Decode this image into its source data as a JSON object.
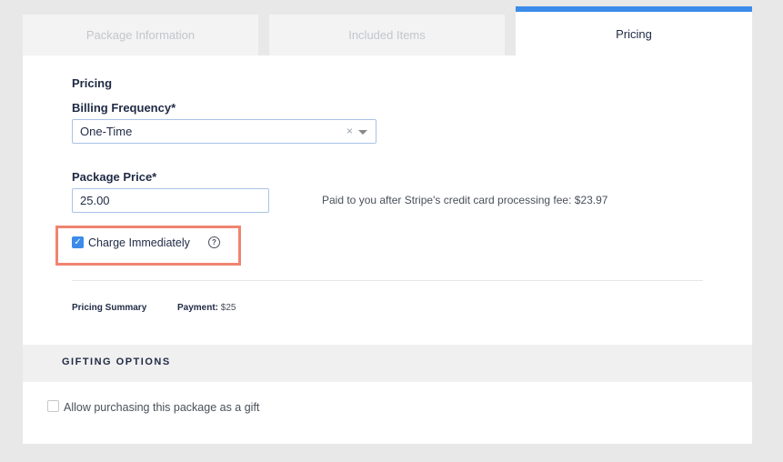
{
  "tabs": [
    {
      "label": "Package Information"
    },
    {
      "label": "Included Items"
    },
    {
      "label": "Pricing"
    }
  ],
  "colors": {
    "accent": "#3b8bea",
    "highlight": "#f08470"
  },
  "pricing": {
    "section_title": "Pricing",
    "billing_label": "Billing Frequency*",
    "billing_value": "One-Time",
    "clear_glyph": "×",
    "price_label": "Package Price*",
    "price_value": "25.00",
    "fee_note": "Paid to you after Stripe's credit card processing fee: $23.97",
    "charge_label": "Charge Immediately",
    "charge_checked": true,
    "help_glyph": "?"
  },
  "summary": {
    "label": "Pricing Summary",
    "payment_label": "Payment:",
    "payment_value": "$25"
  },
  "gifting": {
    "header": "GIFTING OPTIONS",
    "gift_label": "Allow purchasing this package as a gift",
    "gift_checked": false
  }
}
